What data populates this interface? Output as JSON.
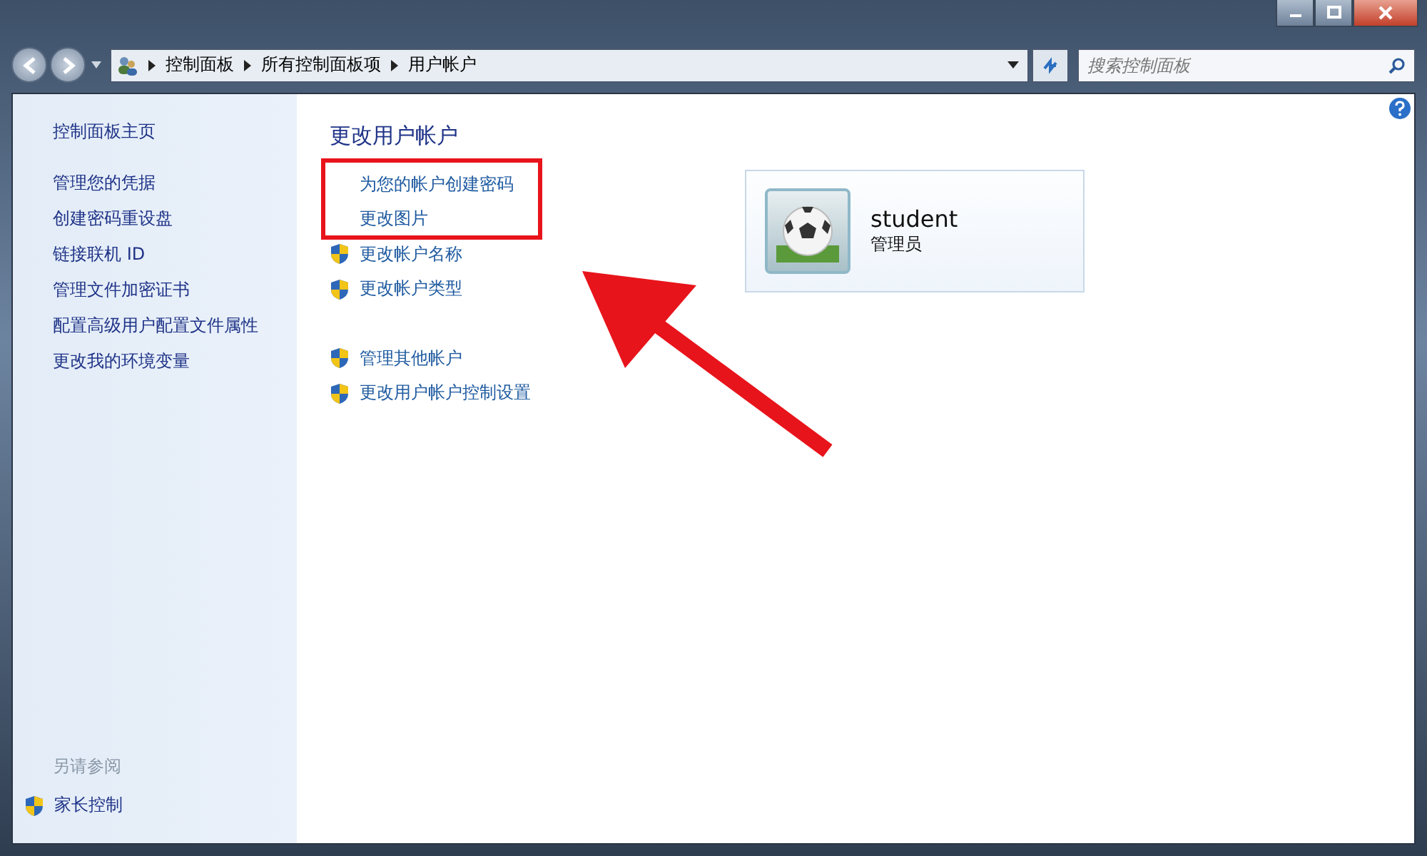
{
  "address_bar": {
    "breadcrumbs": [
      "控制面板",
      "所有控制面板项",
      "用户帐户"
    ]
  },
  "search": {
    "placeholder": "搜索控制面板"
  },
  "sidebar": {
    "items": [
      {
        "label": "控制面板主页",
        "kind": "home"
      },
      {
        "label": "管理您的凭据",
        "kind": "task"
      },
      {
        "label": "创建密码重设盘",
        "kind": "task"
      },
      {
        "label": "链接联机 ID",
        "kind": "task"
      },
      {
        "label": "管理文件加密证书",
        "kind": "task"
      },
      {
        "label": "配置高级用户配置文件属性",
        "kind": "task"
      },
      {
        "label": "更改我的环境变量",
        "kind": "task"
      }
    ],
    "see_also": {
      "heading": "另请参阅",
      "items": [
        {
          "label": "家长控制",
          "shield": true
        }
      ]
    }
  },
  "main": {
    "title": "更改用户帐户",
    "groups": [
      [
        {
          "label": "为您的帐户创建密码",
          "shield": false
        },
        {
          "label": "更改图片",
          "shield": false
        },
        {
          "label": "更改帐户名称",
          "shield": true
        },
        {
          "label": "更改帐户类型",
          "shield": true
        }
      ],
      [
        {
          "label": "管理其他帐户",
          "shield": true
        },
        {
          "label": "更改用户帐户控制设置",
          "shield": true
        }
      ]
    ]
  },
  "account": {
    "name": "student",
    "role": "管理员"
  }
}
